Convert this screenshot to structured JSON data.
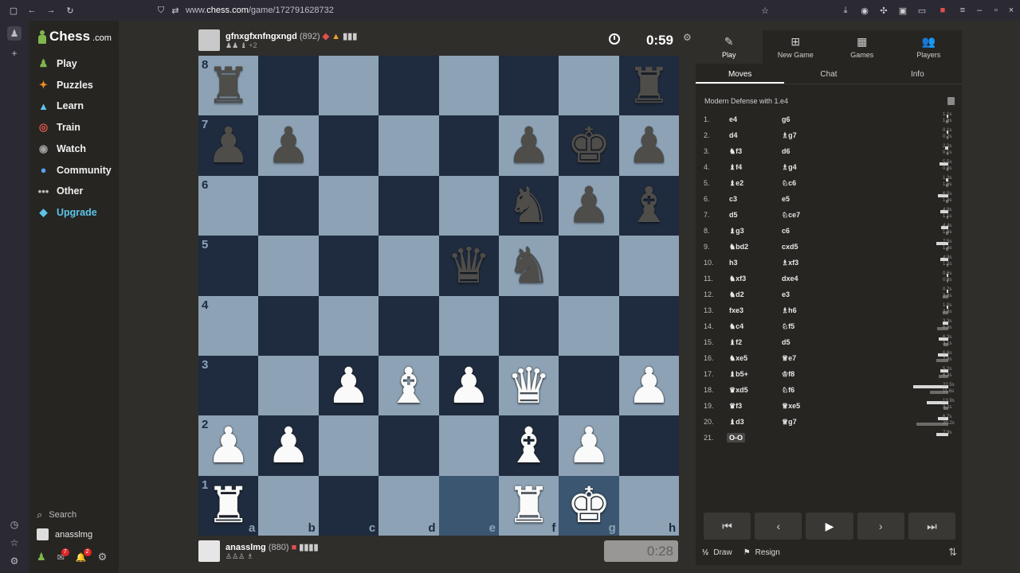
{
  "browser": {
    "url_prefix": "www.",
    "url_host": "chess.com",
    "url_path": "/game/172791628732"
  },
  "sidebar": {
    "logo_text": "Chess",
    "logo_suffix": ".com",
    "items": [
      {
        "label": "Play",
        "icon": "♟",
        "color": "#81b64c"
      },
      {
        "label": "Puzzles",
        "icon": "✦",
        "color": "#f08a24"
      },
      {
        "label": "Learn",
        "icon": "▲",
        "color": "#5dc4e8"
      },
      {
        "label": "Train",
        "icon": "◎",
        "color": "#e0574f"
      },
      {
        "label": "Watch",
        "icon": "◉",
        "color": "#a0a0a0"
      },
      {
        "label": "Community",
        "icon": "●",
        "color": "#5aa0e8"
      },
      {
        "label": "Other",
        "icon": "•••",
        "color": "#bdbdbd"
      },
      {
        "label": "Upgrade",
        "icon": "◆",
        "color": "#5dc4e8"
      }
    ],
    "search_label": "Search",
    "username": "anasslmg",
    "mail_badge": "7",
    "notif_badge": "2"
  },
  "opponent": {
    "name": "gfnxgfxnfngxngd",
    "rating": "(892)",
    "extra": "+2",
    "clock": "0:59"
  },
  "player": {
    "name": "anasslmg",
    "rating": "(880)",
    "clock": "0:28"
  },
  "board": {
    "ranks": [
      "8",
      "7",
      "6",
      "5",
      "4",
      "3",
      "2",
      "1"
    ],
    "files": [
      "a",
      "b",
      "c",
      "d",
      "e",
      "f",
      "g",
      "h"
    ],
    "position": [
      [
        "bR",
        "",
        "",
        "",
        "",
        "",
        "",
        "bR"
      ],
      [
        "bP",
        "bP",
        "",
        "",
        "",
        "bP",
        "bK",
        "bP"
      ],
      [
        "",
        "",
        "",
        "",
        "",
        "bN",
        "bP",
        "bB"
      ],
      [
        "",
        "",
        "",
        "",
        "bQ",
        "bN",
        "",
        ""
      ],
      [
        "",
        "",
        "",
        "",
        "",
        "",
        "",
        ""
      ],
      [
        "",
        "",
        "wP",
        "wB",
        "wP",
        "wQ",
        "",
        "wP"
      ],
      [
        "wP",
        "wP",
        "",
        "",
        "",
        "wB",
        "wP",
        ""
      ],
      [
        "wR",
        "",
        "",
        "",
        "",
        "wR",
        "wK",
        ""
      ]
    ],
    "highlighted": [
      "e1",
      "g1"
    ],
    "colors": {
      "light": "#8da2b5",
      "dark": "#1f2b3e",
      "highlight": "#5f7e98"
    }
  },
  "panel": {
    "tabs": [
      {
        "label": "Play",
        "icon": "✎",
        "icon_name": "play-tab-icon"
      },
      {
        "label": "New Game",
        "icon": "⊞",
        "icon_name": "new-game-icon"
      },
      {
        "label": "Games",
        "icon": "▦",
        "icon_name": "games-icon"
      },
      {
        "label": "Players",
        "icon": "👥",
        "icon_name": "players-icon"
      }
    ],
    "subtabs": [
      "Moves",
      "Chat",
      "Info"
    ],
    "opening": "Modern Defense with 1.e4",
    "moves": [
      {
        "n": "1.",
        "w": "e4",
        "b": "g6",
        "wt": "1.1s",
        "bt": "1.6s",
        "wf": 0.05,
        "bf": 0.07
      },
      {
        "n": "2.",
        "w": "d4",
        "b": "♗g7",
        "wt": "0.1s",
        "bt": "0.2s",
        "wf": 0.02,
        "bf": 0.02
      },
      {
        "n": "3.",
        "w": "♞f3",
        "b": "d6",
        "wt": "2.0s",
        "bt": "0.1s",
        "wf": 0.09,
        "bf": 0.02
      },
      {
        "n": "4.",
        "w": "♝f4",
        "b": "♗g4",
        "wt": "5.5s",
        "bt": "0.8s",
        "wf": 0.25,
        "bf": 0.04
      },
      {
        "n": "5.",
        "w": "♝e2",
        "b": "♘c6",
        "wt": "1.3s",
        "bt": "1.5s",
        "wf": 0.06,
        "bf": 0.07
      },
      {
        "n": "6.",
        "w": "c3",
        "b": "e5",
        "wt": "6.5s",
        "bt": "1.3s",
        "wf": 0.29,
        "bf": 0.06
      },
      {
        "n": "7.",
        "w": "d5",
        "b": "♘ce7",
        "wt": "4.9s",
        "bt": "1.1s",
        "wf": 0.22,
        "bf": 0.05
      },
      {
        "n": "8.",
        "w": "♝g3",
        "b": "c6",
        "wt": "4.4s",
        "bt": "1.6s",
        "wf": 0.2,
        "bf": 0.07
      },
      {
        "n": "9.",
        "w": "♞bd2",
        "b": "cxd5",
        "wt": "7.5s",
        "bt": "1.4s",
        "wf": 0.34,
        "bf": 0.06
      },
      {
        "n": "10.",
        "w": "h3",
        "b": "♗xf3",
        "wt": "4.9s",
        "bt": "1.2s",
        "wf": 0.22,
        "bf": 0.05
      },
      {
        "n": "11.",
        "w": "♞xf3",
        "b": "dxe4",
        "wt": "0.6s",
        "bt": "0.9s",
        "wf": 0.03,
        "bf": 0.04
      },
      {
        "n": "12.",
        "w": "♞d2",
        "b": "e3",
        "wt": "0.7s",
        "bt": "3.6s",
        "wf": 0.03,
        "bf": 0.16
      },
      {
        "n": "13.",
        "w": "fxe3",
        "b": "♗h6",
        "wt": "1.0s",
        "bt": "3.8s",
        "wf": 0.05,
        "bf": 0.17
      },
      {
        "n": "14.",
        "w": "♞c4",
        "b": "♘f5",
        "wt": "3.3s",
        "bt": "6.9s",
        "wf": 0.15,
        "bf": 0.31
      },
      {
        "n": "15.",
        "w": "♝f2",
        "b": "d5",
        "wt": "6.3s",
        "bt": "3.1s",
        "wf": 0.28,
        "bf": 0.14
      },
      {
        "n": "16.",
        "w": "♞xe5",
        "b": "♕e7",
        "wt": "6.6s",
        "bt": "7.9s",
        "wf": 0.3,
        "bf": 0.35
      },
      {
        "n": "17.",
        "w": "♝b5+",
        "b": "♔f8",
        "wt": "5.2s",
        "bt": "6.3s",
        "wf": 0.23,
        "bf": 0.28
      },
      {
        "n": "18.",
        "w": "♛xd5",
        "b": "♘f6",
        "wt": "22.5s",
        "bt": "11.6s",
        "wf": 1.0,
        "bf": 0.52
      },
      {
        "n": "19.",
        "w": "♛f3",
        "b": "♕xe5",
        "wt": "13.9s",
        "bt": "3.2s",
        "wf": 0.62,
        "bf": 0.14
      },
      {
        "n": "20.",
        "w": "♝d3",
        "b": "♕g7",
        "wt": "6.7s",
        "bt": "20.2s",
        "wf": 0.3,
        "bf": 0.9
      },
      {
        "n": "21.",
        "w": "O-O",
        "b": "",
        "wt": "7.9s",
        "bt": "",
        "wf": 0.35,
        "bf": 0
      }
    ],
    "controls": [
      "⏮",
      "‹",
      "▶",
      "›",
      "⏭"
    ],
    "draw_label": "Draw",
    "resign_label": "Resign"
  }
}
